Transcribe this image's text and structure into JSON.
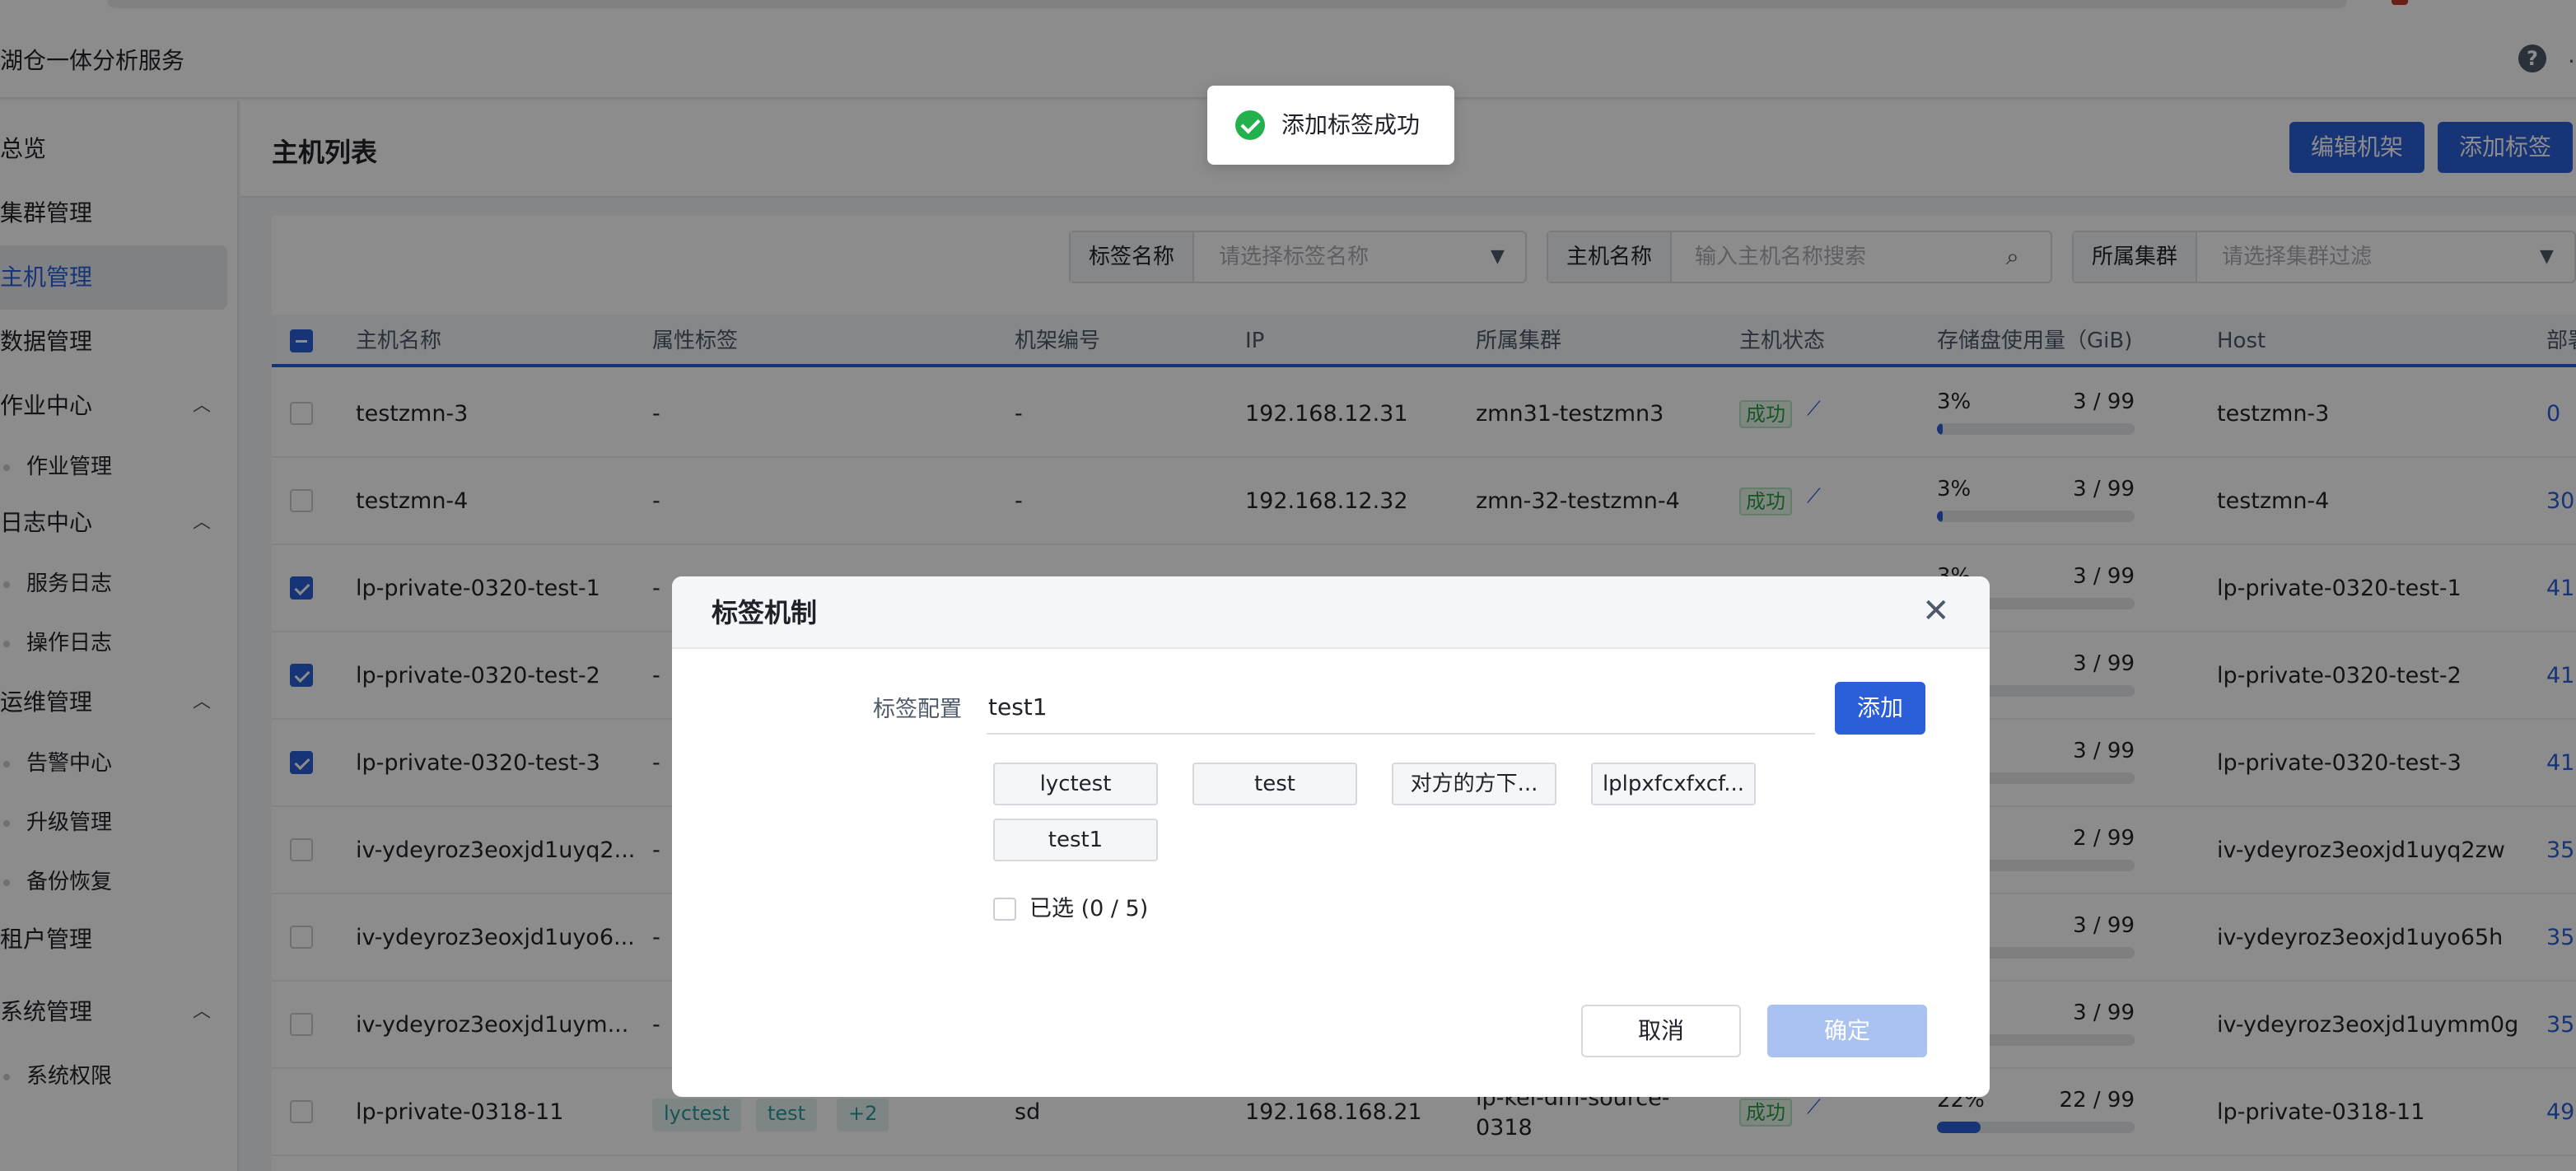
{
  "app": {
    "title": "湖仓一体分析服务",
    "header_more": "..."
  },
  "sidebar": {
    "items": [
      {
        "label": "总览",
        "chevron": ""
      },
      {
        "label": "集群管理",
        "chevron": ""
      },
      {
        "label": "主机管理",
        "chevron": ""
      },
      {
        "label": "数据管理",
        "chevron": ""
      },
      {
        "label": "作业中心",
        "chevron": "^"
      },
      {
        "label": "作业管理",
        "chevron": ""
      },
      {
        "label": "日志中心",
        "chevron": "^"
      },
      {
        "label": "服务日志",
        "chevron": ""
      },
      {
        "label": "操作日志",
        "chevron": ""
      },
      {
        "label": "运维管理",
        "chevron": "^"
      },
      {
        "label": "告警中心",
        "chevron": ""
      },
      {
        "label": "升级管理",
        "chevron": ""
      },
      {
        "label": "备份恢复",
        "chevron": ""
      },
      {
        "label": "租户管理",
        "chevron": ""
      },
      {
        "label": "系统管理",
        "chevron": "^"
      },
      {
        "label": "系统权限",
        "chevron": ""
      }
    ]
  },
  "page": {
    "title": "主机列表",
    "edit_rack_label": "编辑机架",
    "add_tag_label": "添加标签"
  },
  "filters": {
    "tag": {
      "label": "标签名称",
      "placeholder": "请选择标签名称"
    },
    "host": {
      "label": "主机名称",
      "placeholder": "输入主机名称搜索"
    },
    "cluster": {
      "label": "所属集群",
      "placeholder": "请选择集群过滤"
    }
  },
  "table": {
    "columns": [
      "主机名称",
      "属性标签",
      "机架编号",
      "IP",
      "所属集群",
      "主机状态",
      "存储盘使用量（GiB)",
      "Host",
      "部署"
    ],
    "rows": [
      {
        "name": "testzmn-3",
        "tags": "-",
        "rack": "-",
        "ip": "192.168.12.31",
        "cluster": "zmn31-testzmn3",
        "status": "成功",
        "pct": "3%",
        "frac": "3 / 99",
        "usage": 0.03,
        "host": "testzmn-3",
        "deploy": "0",
        "checked": false
      },
      {
        "name": "testzmn-4",
        "tags": "-",
        "rack": "-",
        "ip": "192.168.12.32",
        "cluster": "zmn-32-testzmn-4",
        "status": "成功",
        "pct": "3%",
        "frac": "3 / 99",
        "usage": 0.03,
        "host": "testzmn-4",
        "deploy": "30",
        "checked": false
      },
      {
        "name": "lp-private-0320-test-1",
        "tags": "-",
        "rack": "",
        "ip": "",
        "cluster": "",
        "status": "",
        "pct": "3%",
        "frac": "3 / 99",
        "usage": 0.03,
        "host": "lp-private-0320-test-1",
        "deploy": "41",
        "checked": true
      },
      {
        "name": "lp-private-0320-test-2",
        "tags": "-",
        "rack": "",
        "ip": "",
        "cluster": "",
        "status": "",
        "pct": "",
        "frac": "3 / 99",
        "usage": 0.03,
        "host": "lp-private-0320-test-2",
        "deploy": "41",
        "checked": true
      },
      {
        "name": "lp-private-0320-test-3",
        "tags": "-",
        "rack": "",
        "ip": "",
        "cluster": "",
        "status": "",
        "pct": "",
        "frac": "3 / 99",
        "usage": 0.03,
        "host": "lp-private-0320-test-3",
        "deploy": "41",
        "checked": true
      },
      {
        "name": "iv-ydeyroz3eoxjd1uyq2...",
        "tags": "-",
        "rack": "",
        "ip": "",
        "cluster": "",
        "status": "",
        "pct": "",
        "frac": "2 / 99",
        "usage": 0.02,
        "host": "iv-ydeyroz3eoxjd1uyq2zw",
        "deploy": "35",
        "checked": false
      },
      {
        "name": "iv-ydeyroz3eoxjd1uyo6...",
        "tags": "-",
        "rack": "",
        "ip": "",
        "cluster": "",
        "status": "",
        "pct": "",
        "frac": "3 / 99",
        "usage": 0.03,
        "host": "iv-ydeyroz3eoxjd1uyo65h",
        "deploy": "35",
        "checked": false
      },
      {
        "name": "iv-ydeyroz3eoxjd1uym...",
        "tags": "-",
        "rack": "",
        "ip": "",
        "cluster": "",
        "status": "",
        "pct": "",
        "frac": "3 / 99",
        "usage": 0.03,
        "host": "iv-ydeyroz3eoxjd1uymm0g",
        "deploy": "35",
        "checked": false
      },
      {
        "name": "lp-private-0318-11",
        "tags": "",
        "tag_chips": [
          "lyctest",
          "test",
          "+2"
        ],
        "rack": "sd",
        "ip": "192.168.168.21",
        "cluster": "lp-kei-dm-source-0318",
        "status": "成功",
        "pct": "22%",
        "frac": "22 / 99",
        "usage": 0.22,
        "host": "lp-private-0318-11",
        "deploy": "49",
        "checked": false
      }
    ]
  },
  "toast": {
    "message": "添加标签成功"
  },
  "modal": {
    "title": "标签机制",
    "close": "✕",
    "field_label": "标签配置",
    "input_value": "test1",
    "add_label": "添加",
    "chips": [
      "lyctest",
      "test",
      "对方的方下...",
      "lplpxfcxfxcf...",
      "test1"
    ],
    "selected_text": "已选 (0 / 5)",
    "cancel_label": "取消",
    "confirm_label": "确定"
  },
  "colors": {
    "primary": "#2b5fd9",
    "success": "#23b14d",
    "disabled_primary": "#a9c2f2"
  },
  "icons": {
    "help": "question-circle-icon",
    "search": "search-icon",
    "dropdown": "caret-down-icon",
    "trend": "line-chart-icon",
    "close": "close-icon",
    "success": "check-circle-icon"
  }
}
